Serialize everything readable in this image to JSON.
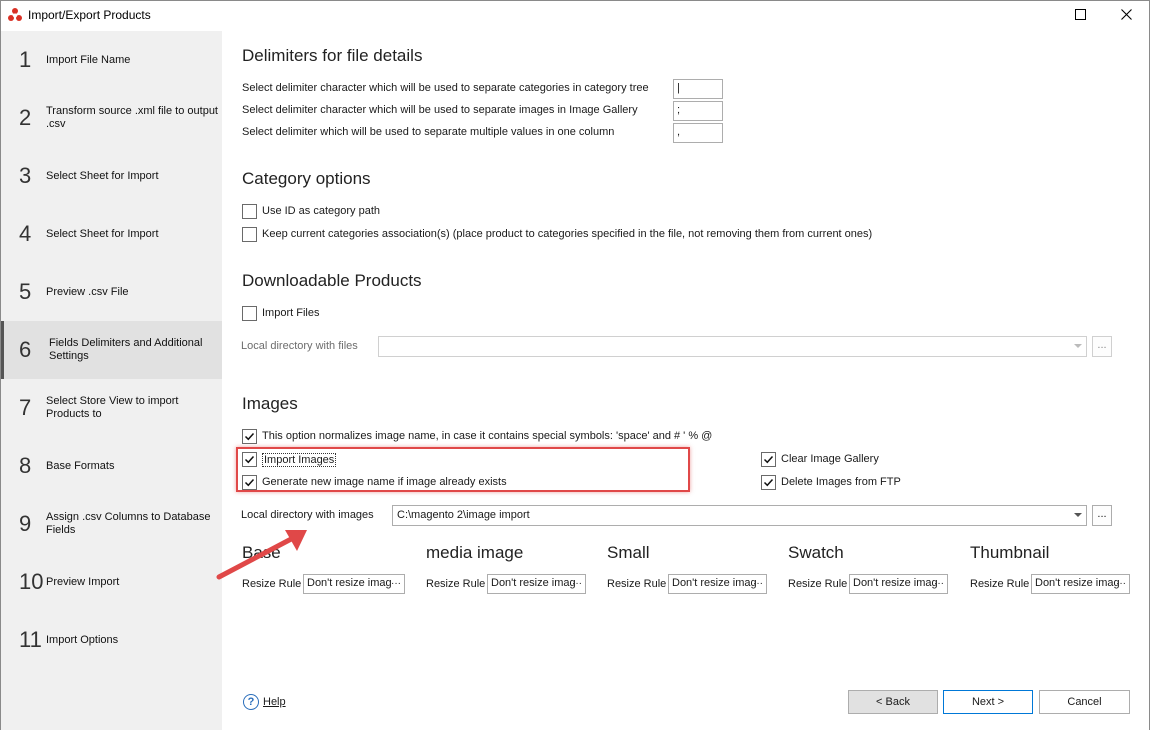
{
  "window": {
    "title": "Import/Export Products"
  },
  "sidebar": {
    "steps": [
      {
        "num": "1",
        "label": "Import File Name"
      },
      {
        "num": "2",
        "label": "Transform source .xml file to output .csv"
      },
      {
        "num": "3",
        "label": "Select Sheet for Import"
      },
      {
        "num": "4",
        "label": "Select Sheet for Import"
      },
      {
        "num": "5",
        "label": "Preview .csv File"
      },
      {
        "num": "6",
        "label": "Fields Delimiters and Additional Settings"
      },
      {
        "num": "7",
        "label": "Select Store View to import Products to"
      },
      {
        "num": "8",
        "label": "Base Formats"
      },
      {
        "num": "9",
        "label": "Assign .csv Columns to Database Fields"
      },
      {
        "num": "10",
        "label": "Preview Import"
      },
      {
        "num": "11",
        "label": "Import Options"
      }
    ],
    "active_index": 5
  },
  "delimiters": {
    "heading": "Delimiters for file details",
    "category_label": "Select delimiter character which will be used to separate categories in category tree",
    "category_value": "|",
    "images_label": "Select delimiter character which will be used to separate images in Image Gallery",
    "images_value": ";",
    "multi_label": "Select delimiter which will be used to separate multiple values in one column",
    "multi_value": ","
  },
  "category_options": {
    "heading": "Category options",
    "use_id_label": "Use ID as category path",
    "use_id_checked": false,
    "keep_assoc_label": "Keep current categories association(s) (place product to categories specified in the file, not removing them from current ones)",
    "keep_assoc_checked": false
  },
  "downloadable": {
    "heading": "Downloadable Products",
    "import_files_label": "Import Files",
    "import_files_checked": false,
    "local_dir_label": "Local directory with files",
    "local_dir_value": "",
    "browse_label": "..."
  },
  "images": {
    "heading": "Images",
    "normalize_label": "This option normalizes image name, in case it contains special symbols: 'space' and # ' % @",
    "normalize_checked": true,
    "import_images_label": "Import Images",
    "import_images_checked": true,
    "generate_name_label": "Generate new image name if image already exists",
    "generate_name_checked": true,
    "clear_gallery_label": "Clear Image Gallery",
    "clear_gallery_checked": true,
    "delete_ftp_label": "Delete Images from FTP",
    "delete_ftp_checked": true,
    "local_dir_label": "Local directory with images",
    "local_dir_value": "C:\\magento 2\\image import",
    "browse_label": "...",
    "resize_rule_label": "Resize Rule",
    "types": [
      {
        "title": "Base",
        "value": "Don't resize imag"
      },
      {
        "title": "media image",
        "value": "Don't resize imag"
      },
      {
        "title": "Small",
        "value": "Don't resize imag"
      },
      {
        "title": "Swatch",
        "value": "Don't resize imag"
      },
      {
        "title": "Thumbnail",
        "value": "Don't resize imag"
      }
    ]
  },
  "footer": {
    "help_label": "Help",
    "back_label": "< Back",
    "next_label": "Next >",
    "cancel_label": "Cancel"
  },
  "colors": {
    "highlight": "#e04848",
    "accent": "#0078d7",
    "sidebar_bg": "#f0f0f0"
  }
}
